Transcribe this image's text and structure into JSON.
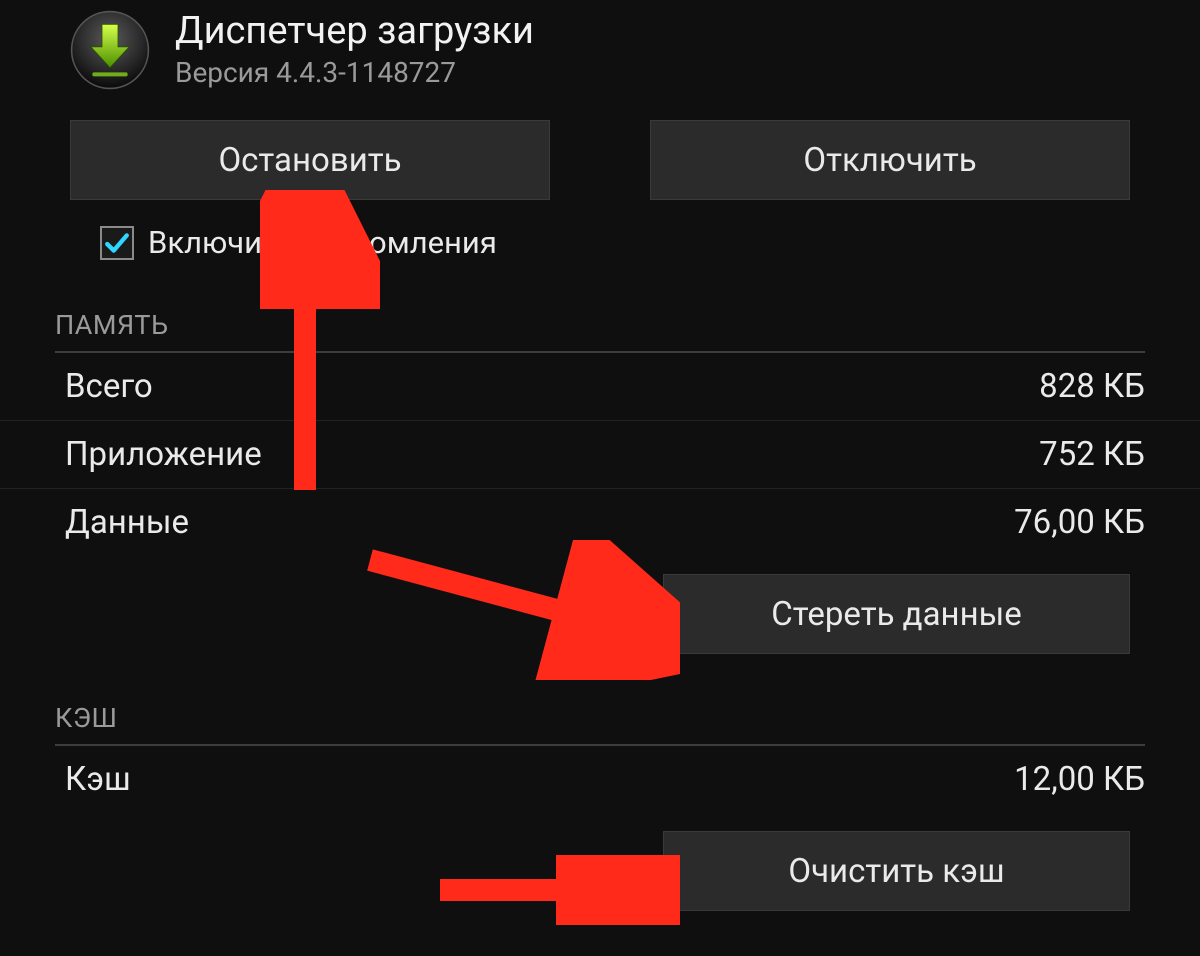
{
  "app": {
    "title": "Диспетчер загрузки",
    "version": "Версия 4.4.3-1148727"
  },
  "buttons": {
    "stop": "Остановить",
    "disable": "Отключить",
    "clear_data": "Стереть данные",
    "clear_cache": "Очистить кэш"
  },
  "checkbox": {
    "enable_notifications": "Включить уведомления",
    "checked": true
  },
  "sections": {
    "memory": "ПАМЯТЬ",
    "cache": "КЭШ"
  },
  "memory": {
    "total_label": "Всего",
    "total_value": "828 КБ",
    "app_label": "Приложение",
    "app_value": "752 КБ",
    "data_label": "Данные",
    "data_value": "76,00 КБ"
  },
  "cache": {
    "label": "Кэш",
    "value": "12,00 КБ"
  }
}
